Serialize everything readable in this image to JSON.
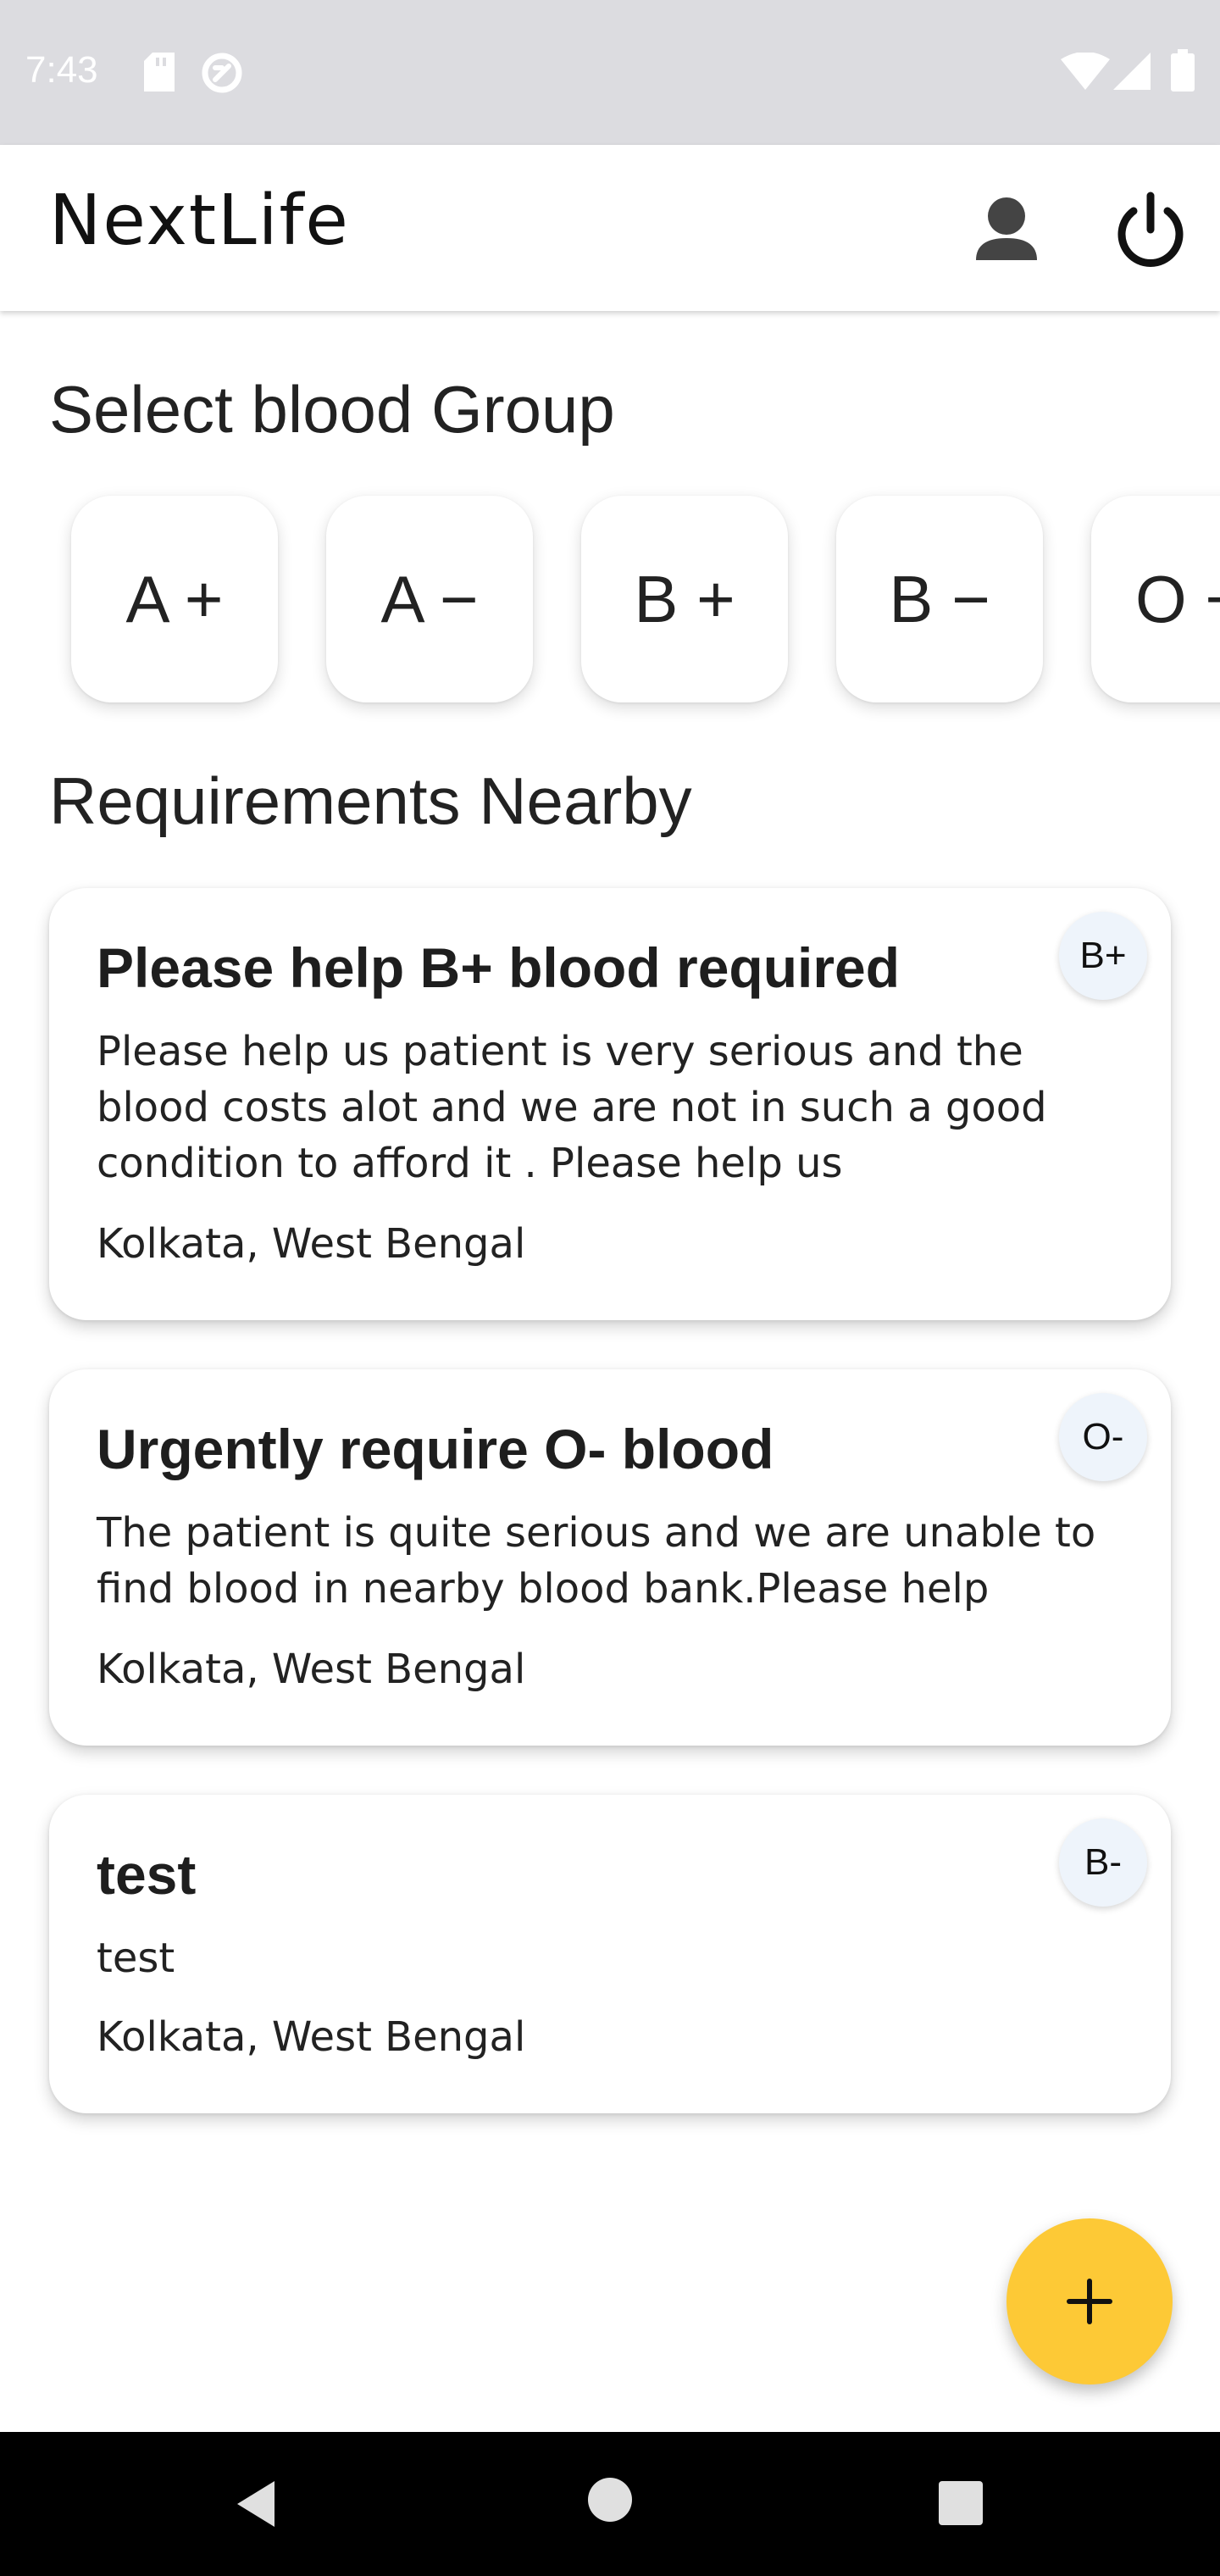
{
  "status_bar": {
    "time": "7:43",
    "icons": [
      "sd-card-icon",
      "data-saver-icon",
      "wifi-icon",
      "signal-icon",
      "battery-icon"
    ]
  },
  "app_bar": {
    "title": "NextLife",
    "icons": [
      "profile-icon",
      "power-icon"
    ]
  },
  "blood_group_section": {
    "title": "Select blood Group",
    "groups": [
      "A +",
      "A −",
      "B +",
      "B −",
      "O +"
    ]
  },
  "requirements_section": {
    "title": "Requirements Nearby",
    "cards": [
      {
        "title": "Please help B+ blood required",
        "description": "Please help us patient is very serious and the blood costs alot and we are not in such a good condition to afford it . Please help us",
        "location": "Kolkata, West Bengal",
        "blood_group": "B+"
      },
      {
        "title": "Urgently require O- blood",
        "description": "The patient is quite serious and we are unable to find blood in nearby blood bank.Please help",
        "location": "Kolkata, West Bengal",
        "blood_group": "O-"
      },
      {
        "title": "test",
        "description": "test",
        "location": "Kolkata, West Bengal",
        "blood_group": "B-"
      }
    ]
  },
  "fab": {
    "icon": "plus-icon",
    "color": "#fdc936"
  },
  "nav_bar": {
    "icons": [
      "back-icon",
      "home-icon",
      "recents-icon"
    ]
  }
}
